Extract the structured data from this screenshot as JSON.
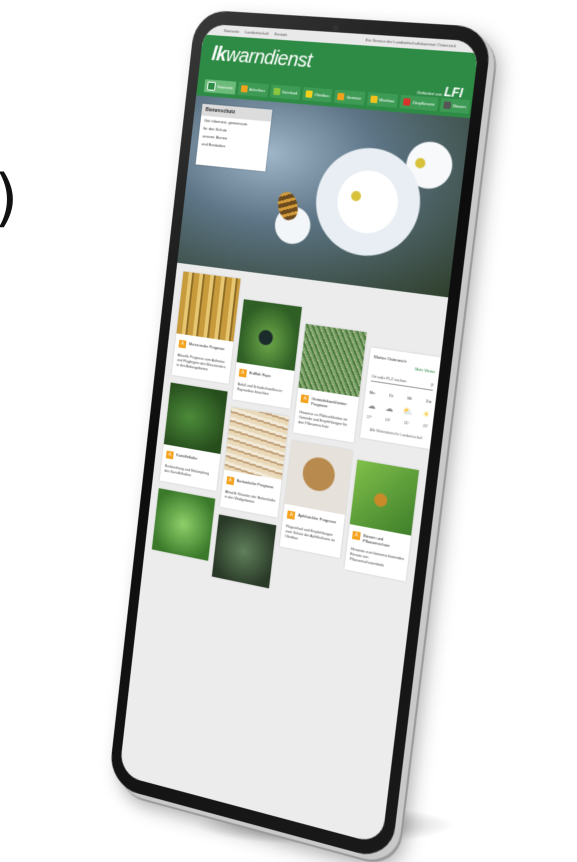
{
  "topbar": {
    "left_items": [
      "Startseite",
      "Landwirtschaft",
      "Kontakt"
    ],
    "right_text": "Ein Service der Landwirtschaftskammer Österreich"
  },
  "header": {
    "logo_bold": "lk",
    "logo_rest": "warndienst",
    "partner_small": "Gefördert von",
    "partner_logo": "LFI",
    "accent": "#2e8b45"
  },
  "nav": [
    {
      "label": "Startseite",
      "color": "#6dbb7a",
      "icon": "home-icon"
    },
    {
      "label": "Ackerbau",
      "color": "#f4a11c",
      "icon": "wheat-icon"
    },
    {
      "label": "Grünland",
      "color": "#8cc63f",
      "icon": "grass-icon"
    },
    {
      "label": "Obstbau",
      "color": "#f4d21c",
      "icon": "fruit-icon"
    },
    {
      "label": "Gemüse",
      "color": "#f4a11c",
      "icon": "vegetable-icon"
    },
    {
      "label": "Weinbau",
      "color": "#f4c21c",
      "icon": "grape-icon"
    },
    {
      "label": "Zierpflanzen",
      "color": "#d9342b",
      "icon": "flower-icon"
    },
    {
      "label": "Bienen",
      "color": "#555555",
      "icon": "bee-icon"
    }
  ],
  "hero": {
    "title": "Bienenschutz",
    "lines": [
      "Gut informiert, gemeinsam",
      "für den Schutz",
      "unserer Bienen",
      "und Bestäuber"
    ]
  },
  "cards": [
    {
      "title": "Maiszünsler Prognose",
      "desc": "Aktuelle Prognose zum Auftreten und Flugbeginn des Maiszünslers in den Anbaugebieten",
      "img": "pest"
    },
    {
      "title": "Erdfloh Raps",
      "desc": "Befall und Schadschwellen im Rapsanbau beachten",
      "img": "beetle"
    },
    {
      "title": "Getreidekrankheiten Prognose",
      "desc": "Hinweise zu Pilzkrankheiten im Getreide und Empfehlungen für den Pflanzenschutz",
      "img": "grass"
    },
    {
      "title": "Kartoffelkäfer",
      "desc": "Beobachtung und Bekämpfung des Kartoffelkäfers",
      "img": "leaf"
    },
    {
      "title": "Borkenkäfer Prognose",
      "desc": "Aktuelle Situation der Borkenkäfer in den Waldgebieten",
      "img": "wood"
    },
    {
      "title": "Apfelwickler Prognose",
      "desc": "Flugverlauf und Empfehlungen zum Schutz der Apfelkulturen im Obstbau",
      "img": "cocoon"
    },
    {
      "title": "Bienen und Pflanzenschutz",
      "desc": "Hinweise zum bienenschonenden Einsatz von Pflanzenschutzmitteln",
      "img": "wasp"
    }
  ],
  "weather": {
    "title": "Wetter Österreich",
    "link": "Mehr Wetter",
    "search": "Ort oder PLZ suchen",
    "days": [
      "Mo",
      "Di",
      "Mi",
      "Do"
    ],
    "temps": [
      "17°",
      "19°",
      "21°",
      "22°"
    ],
    "footer": "Alle Wetterdaten für Landwirtschaft"
  }
}
